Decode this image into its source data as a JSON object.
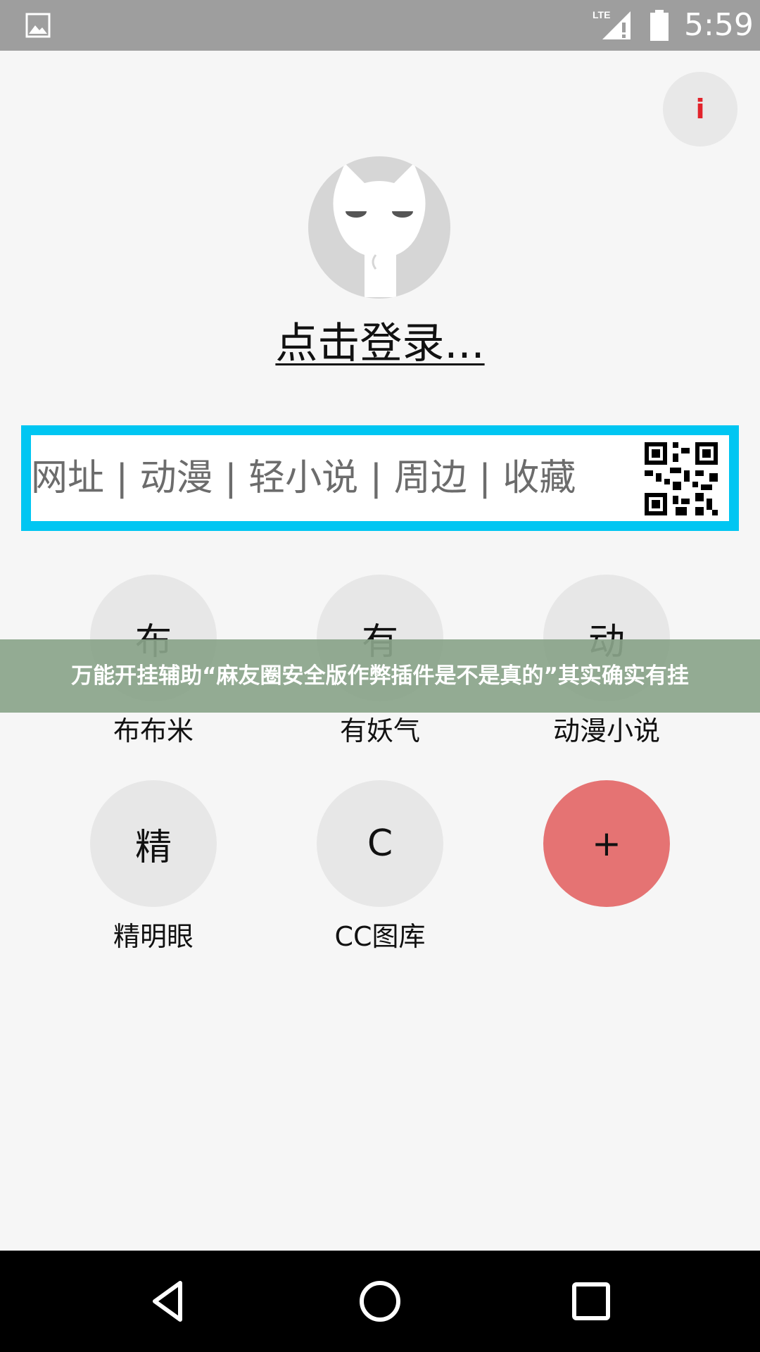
{
  "status_bar": {
    "time": "5:59",
    "icons": [
      "image-icon",
      "lte-signal-icon",
      "battery-icon"
    ]
  },
  "info_button": {
    "label": "i"
  },
  "avatar": {
    "icon": "cat-avatar-icon"
  },
  "login": {
    "label": "点击登录..."
  },
  "search_box": {
    "text": "网址 | 动漫 | 轻小说 | 周边 | 收藏",
    "qr_icon": "qr-code-icon",
    "border_color": "#00c6f2"
  },
  "shortcuts": [
    {
      "glyph": "布",
      "label": "布布米"
    },
    {
      "glyph": "有",
      "label": "有妖气"
    },
    {
      "glyph": "动",
      "label": "动漫小说"
    },
    {
      "glyph": "精",
      "label": "精明眼"
    },
    {
      "glyph": "C",
      "label": "CC图库"
    },
    {
      "glyph": "+",
      "label": ""
    }
  ],
  "overlay_banner": {
    "text": "万能开挂辅助“麻友圈安全版作弊插件是不是真的”其实确实有挂"
  },
  "nav_bar": {
    "buttons": [
      "back-icon",
      "home-icon",
      "recents-icon"
    ]
  },
  "colors": {
    "status_bar": "#9e9e9e",
    "accent": "#00c6f2",
    "add_button": "#e57373",
    "info_icon": "#e2232b"
  }
}
